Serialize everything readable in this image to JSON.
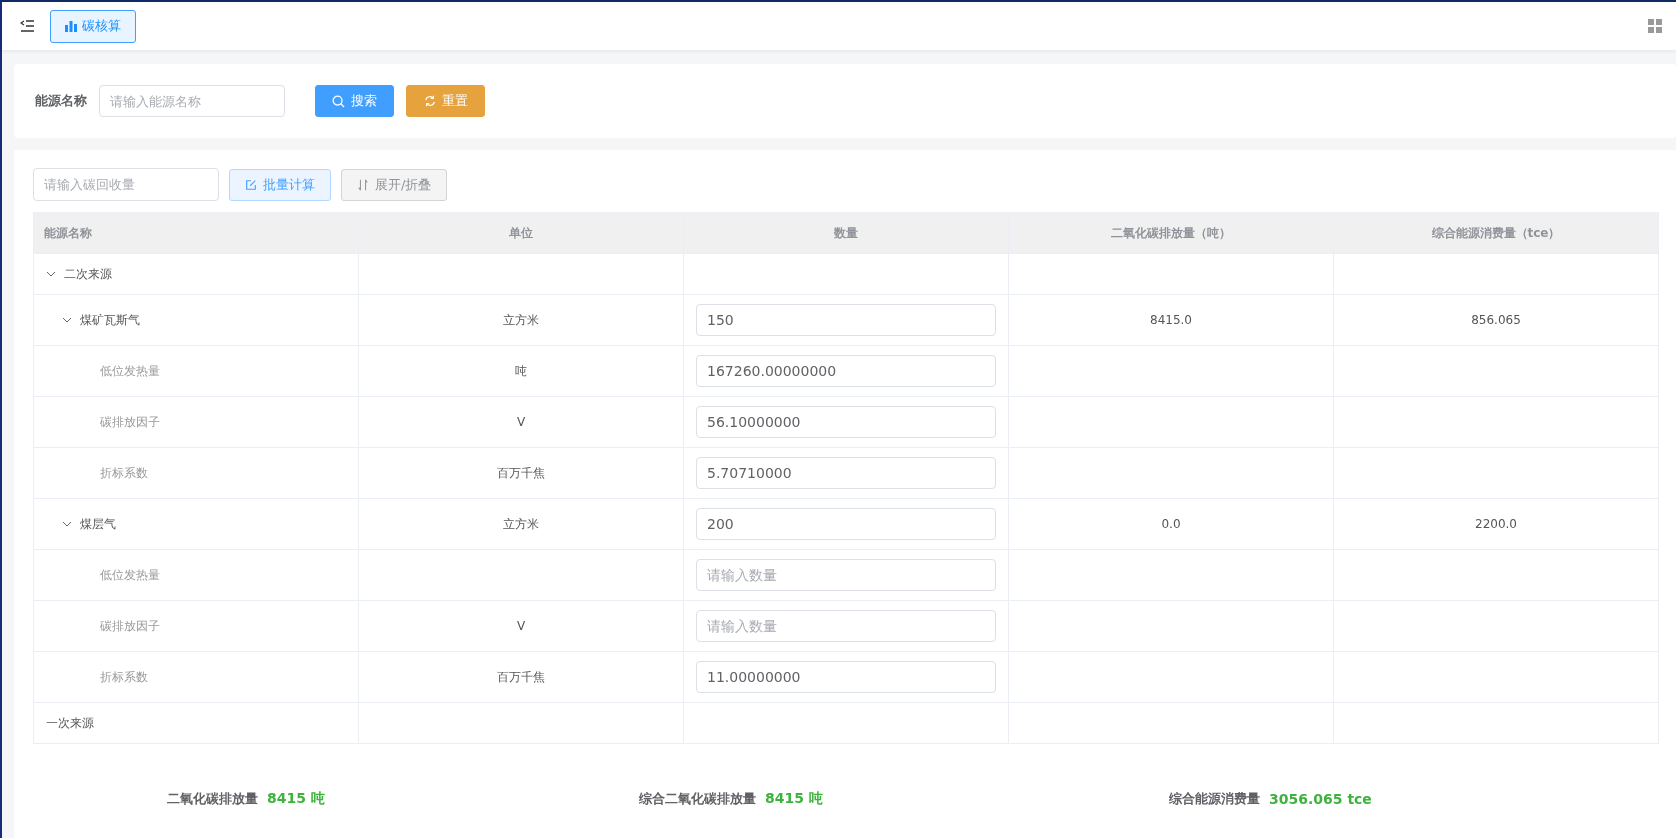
{
  "header": {
    "tab": {
      "label": "碳核算",
      "selected": true
    }
  },
  "search": {
    "label": "能源名称",
    "placeholder": "请输入能源名称",
    "buttons": [
      {
        "label": "搜索",
        "kind": "primary"
      },
      {
        "label": "重置",
        "kind": "warning"
      }
    ]
  },
  "toolbar": {
    "placeholder": "请输入碳回收量",
    "buttons": [
      {
        "label": "批量计算",
        "kind": "plain"
      },
      {
        "label": "展开/折叠",
        "kind": "default"
      }
    ]
  },
  "table": {
    "columns": [
      "能源名称",
      "单位",
      "数量",
      "二氧化碳排放量（吨）",
      "综合能源消费量（tce）"
    ],
    "rows": [
      {
        "name": "二次来源",
        "expanded": true,
        "children": [
          {
            "name": "煤矿瓦斯气",
            "unit": "立方米",
            "quantity": {
              "value": "150"
            },
            "co2": "8415.0",
            "energy": "856.065",
            "expanded": true,
            "children": [
              {
                "name": "低位发热量",
                "unit": "吨",
                "quantity": {
                  "value": "167260.00000000"
                }
              },
              {
                "name": "碳排放因子",
                "unit": "V",
                "quantity": {
                  "value": "56.10000000"
                }
              },
              {
                "name": "折标系数",
                "unit": "百万千焦",
                "quantity": {
                  "value": "5.70710000"
                }
              }
            ]
          },
          {
            "name": "煤层气",
            "unit": "立方米",
            "quantity": {
              "value": "200"
            },
            "co2": "0.0",
            "energy": "2200.0",
            "expanded": true,
            "children": [
              {
                "name": "低位发热量",
                "quantity": {
                  "placeholder": "请输入数量"
                }
              },
              {
                "name": "碳排放因子",
                "unit": "V",
                "quantity": {
                  "placeholder": "请输入数量"
                }
              },
              {
                "name": "折标系数",
                "unit": "百万千焦",
                "quantity": {
                  "value": "11.00000000"
                }
              }
            ]
          }
        ]
      },
      {
        "name": "一次来源"
      }
    ]
  },
  "summary": [
    {
      "label": "二氧化碳排放量",
      "value": "8415 吨"
    },
    {
      "label": "综合二氧化碳排放量",
      "value": "8415 吨"
    },
    {
      "label": "综合能源消费量",
      "value": "3056.065 tce"
    }
  ]
}
